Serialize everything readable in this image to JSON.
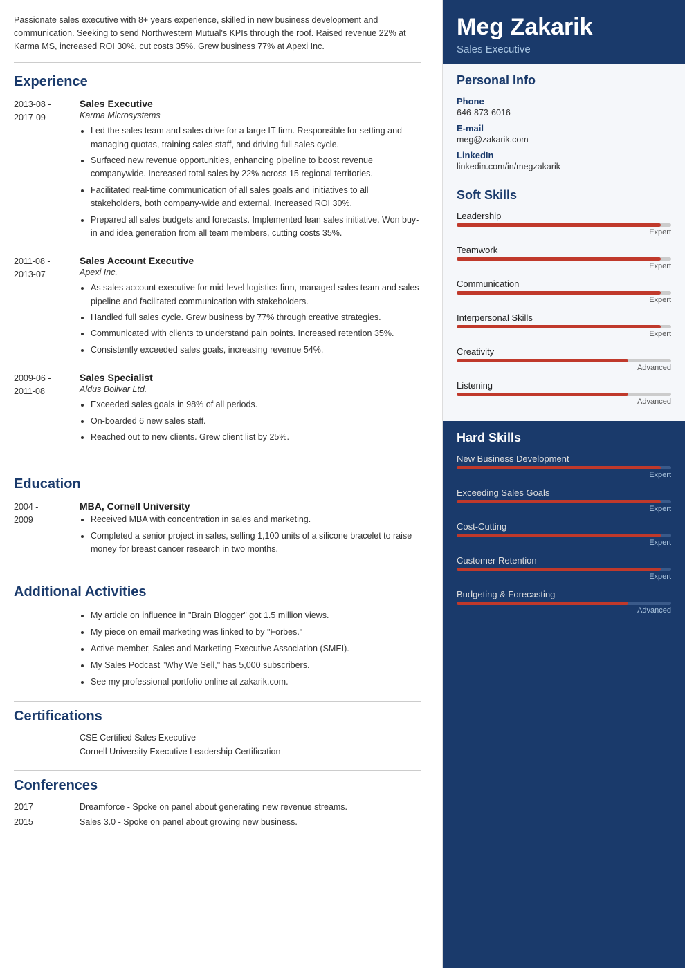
{
  "header": {
    "name": "Meg Zakarik",
    "job_title": "Sales Executive"
  },
  "summary": "Passionate sales executive with 8+ years experience, skilled in new business development and communication. Seeking to send Northwestern Mutual's KPIs through the roof. Raised revenue 22% at Karma MS, increased ROI 30%, cut costs 35%. Grew business 77% at Apexi Inc.",
  "sections": {
    "experience_label": "Experience",
    "education_label": "Education",
    "additional_label": "Additional Activities",
    "certifications_label": "Certifications",
    "conferences_label": "Conferences"
  },
  "experience": [
    {
      "start": "2013-08 -",
      "end": "2017-09",
      "title": "Sales Executive",
      "company": "Karma Microsystems",
      "bullets": [
        "Led the sales team and sales drive for a large IT firm. Responsible for setting and managing quotas, training sales staff, and driving full sales cycle.",
        "Surfaced new revenue opportunities, enhancing pipeline to boost revenue companywide. Increased total sales by 22% across 15 regional territories.",
        "Facilitated real-time communication of all sales goals and initiatives to all stakeholders, both company-wide and external. Increased ROI 30%.",
        "Prepared all sales budgets and forecasts. Implemented lean sales initiative. Won buy-in and idea generation from all team members, cutting costs 35%."
      ]
    },
    {
      "start": "2011-08 -",
      "end": "2013-07",
      "title": "Sales Account Executive",
      "company": "Apexi Inc.",
      "bullets": [
        "As sales account executive for mid-level logistics firm, managed sales team and sales pipeline and facilitated communication with stakeholders.",
        "Handled full sales cycle. Grew business by 77% through creative strategies.",
        "Communicated with clients to understand pain points. Increased retention 35%.",
        "Consistently exceeded sales goals, increasing revenue 54%."
      ]
    },
    {
      "start": "2009-06 -",
      "end": "2011-08",
      "title": "Sales Specialist",
      "company": "Aldus Bolivar Ltd.",
      "bullets": [
        "Exceeded sales goals in 98% of all periods.",
        "On-boarded 6 new sales staff.",
        "Reached out to new clients. Grew client list by 25%."
      ]
    }
  ],
  "education": [
    {
      "start": "2004 -",
      "end": "2009",
      "title": "MBA, Cornell University",
      "bullets": [
        "Received MBA with concentration in sales and marketing.",
        "Completed a senior project in sales, selling 1,100 units of a silicone bracelet to raise money for breast cancer research in two months."
      ]
    }
  ],
  "additional_activities": [
    "My article on influence in \"Brain Blogger\" got 1.5 million views.",
    "My piece on email marketing was linked to by \"Forbes.\"",
    "Active member, Sales and Marketing Executive Association (SMEI).",
    "My Sales Podcast \"Why We Sell,\" has 5,000 subscribers.",
    "See my professional portfolio online at zakarik.com."
  ],
  "certifications": [
    "CSE Certified Sales Executive",
    "Cornell University Executive Leadership Certification"
  ],
  "conferences": [
    {
      "year": "2017",
      "description": "Dreamforce - Spoke on panel about generating new revenue streams."
    },
    {
      "year": "2015",
      "description": "Sales 3.0 - Spoke on panel about growing new business."
    }
  ],
  "personal_info": {
    "section_label": "Personal Info",
    "phone_label": "Phone",
    "phone": "646-873-6016",
    "email_label": "E-mail",
    "email": "meg@zakarik.com",
    "linkedin_label": "LinkedIn",
    "linkedin": "linkedin.com/in/megzakarik"
  },
  "soft_skills": {
    "section_label": "Soft Skills",
    "skills": [
      {
        "name": "Leadership",
        "level": "Expert",
        "pct": 95
      },
      {
        "name": "Teamwork",
        "level": "Expert",
        "pct": 95
      },
      {
        "name": "Communication",
        "level": "Expert",
        "pct": 95
      },
      {
        "name": "Interpersonal Skills",
        "level": "Expert",
        "pct": 95
      },
      {
        "name": "Creativity",
        "level": "Advanced",
        "pct": 80
      },
      {
        "name": "Listening",
        "level": "Advanced",
        "pct": 80
      }
    ]
  },
  "hard_skills": {
    "section_label": "Hard Skills",
    "skills": [
      {
        "name": "New Business Development",
        "level": "Expert",
        "pct": 95
      },
      {
        "name": "Exceeding Sales Goals",
        "level": "Expert",
        "pct": 95
      },
      {
        "name": "Cost-Cutting",
        "level": "Expert",
        "pct": 95
      },
      {
        "name": "Customer Retention",
        "level": "Expert",
        "pct": 95
      },
      {
        "name": "Budgeting & Forecasting",
        "level": "Advanced",
        "pct": 80
      }
    ]
  }
}
